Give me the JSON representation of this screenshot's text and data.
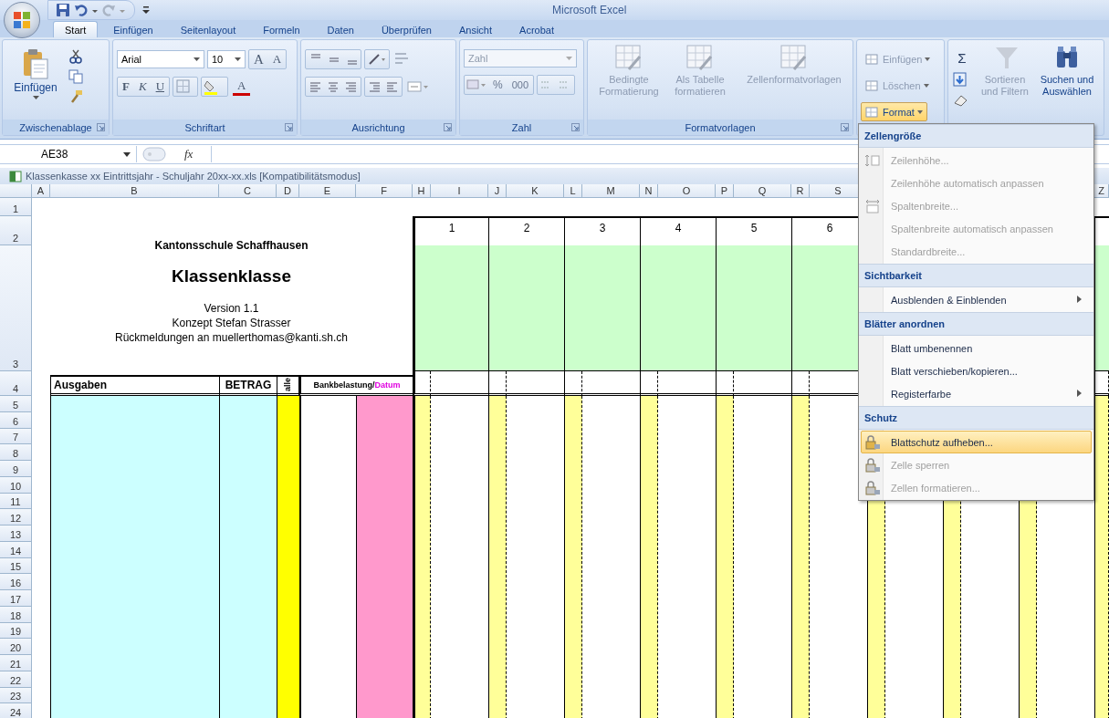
{
  "window": {
    "title": "Microsoft Excel"
  },
  "quick_access": {
    "redo_disabled": true
  },
  "tabs": [
    {
      "label": "Start",
      "selected": true
    },
    {
      "label": "Einfügen",
      "selected": false
    },
    {
      "label": "Seitenlayout",
      "selected": false
    },
    {
      "label": "Formeln",
      "selected": false
    },
    {
      "label": "Daten",
      "selected": false
    },
    {
      "label": "Überprüfen",
      "selected": false
    },
    {
      "label": "Ansicht",
      "selected": false
    },
    {
      "label": "Acrobat",
      "selected": false
    }
  ],
  "ribbon": {
    "clipboard": {
      "label": "Zwischenablage",
      "paste": "Einfügen"
    },
    "font": {
      "label": "Schriftart",
      "family": "Arial",
      "size": "10",
      "grow": "A",
      "shrink": "A",
      "bold": "F",
      "italic": "K",
      "underline": "U",
      "text_color_letter": "A"
    },
    "alignment": {
      "label": "Ausrichtung"
    },
    "number": {
      "label": "Zahl",
      "format": "Zahl",
      "percent": "%",
      "thousands": "000"
    },
    "styles": {
      "label": "Formatvorlagen",
      "buttons": [
        {
          "label": "Bedingte Formatierung",
          "disabled": true
        },
        {
          "label": "Als Tabelle formatieren",
          "disabled": true
        },
        {
          "label": "Zellenformatvorlagen",
          "disabled": true
        }
      ]
    },
    "cells": {
      "buttons": [
        {
          "label": "Einfügen",
          "disabled": true,
          "selected": false
        },
        {
          "label": "Löschen",
          "disabled": true,
          "selected": false
        },
        {
          "label": "Format",
          "disabled": false,
          "selected": true
        }
      ]
    },
    "editing": {
      "sum": "Σ",
      "buttons": [
        {
          "label": "Sortieren und Filtern",
          "disabled": true
        },
        {
          "label": "Suchen und Auswählen",
          "disabled": false
        }
      ]
    }
  },
  "formula_bar": {
    "name_box": "AE38",
    "function_label": "fx"
  },
  "workbook": {
    "title": "Klassenkasse xx Eintrittsjahr - Schuljahr 20xx-xx.xls  [Kompatibilitätsmodus]"
  },
  "sheet": {
    "column_headers": [
      "A",
      "B",
      "C",
      "D",
      "E",
      "F",
      "H",
      "I",
      "J",
      "K",
      "L",
      "M",
      "N",
      "O",
      "P",
      "Q",
      "R",
      "S",
      "Z"
    ],
    "row_headers": [
      "1",
      "2",
      "3",
      "4",
      "5",
      "6",
      "7",
      "8",
      "9",
      "10",
      "11",
      "12",
      "13",
      "14",
      "15",
      "16",
      "17",
      "18",
      "19",
      "20",
      "21",
      "22",
      "23",
      "24"
    ],
    "heading": "Kantonsschule Schaffhausen",
    "title": "Klassenklasse",
    "info_lines": [
      "Version 1.1",
      "Konzept Stefan Strasser",
      "Rückmeldungen an muellerthomas@kanti.sh.ch"
    ],
    "table_headers": {
      "expenses": "Ausgaben",
      "amount": "BETRAG",
      "all": "alle",
      "bank": "Bankbelastung/",
      "date": "Datum"
    },
    "students": [
      "1",
      "2",
      "3",
      "4",
      "5",
      "6"
    ]
  },
  "format_menu": {
    "sections": [
      {
        "title": "Zellengröße",
        "items": [
          {
            "label": "Zeilenhöhe...",
            "disabled": true,
            "icon": true,
            "submenu": false,
            "selected": false
          },
          {
            "label": "Zeilenhöhe automatisch anpassen",
            "disabled": true,
            "icon": false,
            "submenu": false,
            "selected": false
          },
          {
            "label": "Spaltenbreite...",
            "disabled": true,
            "icon": true,
            "submenu": false,
            "selected": false
          },
          {
            "label": "Spaltenbreite automatisch anpassen",
            "disabled": true,
            "icon": false,
            "submenu": false,
            "selected": false
          },
          {
            "label": "Standardbreite...",
            "disabled": true,
            "icon": false,
            "submenu": false,
            "selected": false
          }
        ]
      },
      {
        "title": "Sichtbarkeit",
        "items": [
          {
            "label": "Ausblenden & Einblenden",
            "disabled": false,
            "icon": false,
            "submenu": true,
            "selected": false
          }
        ]
      },
      {
        "title": "Blätter anordnen",
        "items": [
          {
            "label": "Blatt umbenennen",
            "disabled": false,
            "icon": false,
            "submenu": false,
            "selected": false
          },
          {
            "label": "Blatt verschieben/kopieren...",
            "disabled": false,
            "icon": false,
            "submenu": false,
            "selected": false
          },
          {
            "label": "Registerfarbe",
            "disabled": false,
            "icon": false,
            "submenu": true,
            "selected": false
          }
        ]
      },
      {
        "title": "Schutz",
        "items": [
          {
            "label": "Blattschutz aufheben...",
            "disabled": false,
            "icon": true,
            "submenu": false,
            "selected": true
          },
          {
            "label": "Zelle sperren",
            "disabled": true,
            "icon": true,
            "submenu": false,
            "selected": false
          },
          {
            "label": "Zellen formatieren...",
            "disabled": true,
            "icon": true,
            "submenu": false,
            "selected": false
          }
        ]
      }
    ]
  }
}
